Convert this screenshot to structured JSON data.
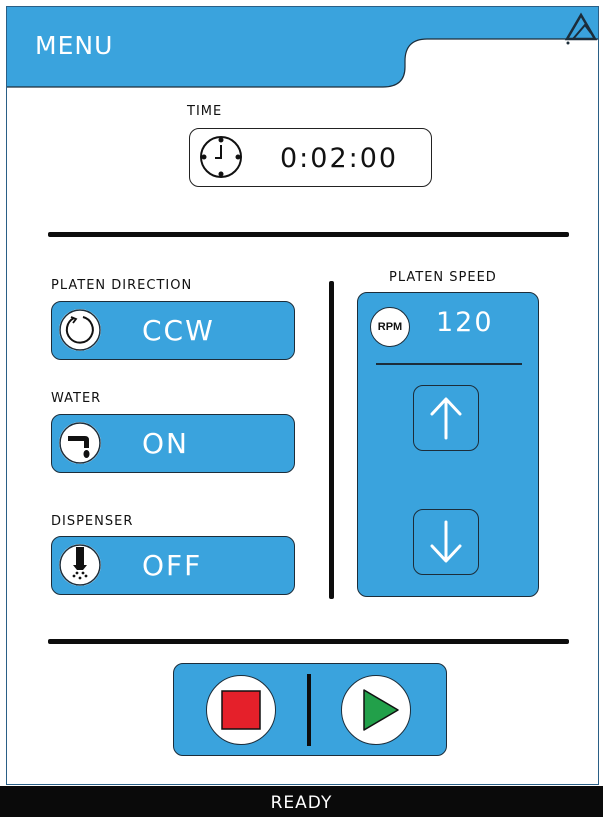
{
  "header": {
    "title": "MENU",
    "logo_icon": "company-logo-icon"
  },
  "time": {
    "label": "TIME",
    "value": "0:02:00",
    "icon": "clock-icon"
  },
  "platen_direction": {
    "label": "PLATEN DIRECTION",
    "value": "CCW",
    "icon": "rotate-ccw-icon"
  },
  "water": {
    "label": "WATER",
    "value": "ON",
    "icon": "water-tap-icon"
  },
  "dispenser": {
    "label": "DISPENSER",
    "value": "OFF",
    "icon": "dispenser-nozzle-icon"
  },
  "platen_speed": {
    "label": "PLATEN SPEED",
    "unit": "RPM",
    "value": "120",
    "up_icon": "arrow-up-icon",
    "down_icon": "arrow-down-icon"
  },
  "controls": {
    "stop_icon": "stop-icon",
    "play_icon": "play-icon"
  },
  "status": {
    "text": "READY"
  },
  "colors": {
    "accent": "#3aa3dd",
    "stop": "#e5202a",
    "play": "#22a04a",
    "status_bar": "#0a0a0a"
  }
}
